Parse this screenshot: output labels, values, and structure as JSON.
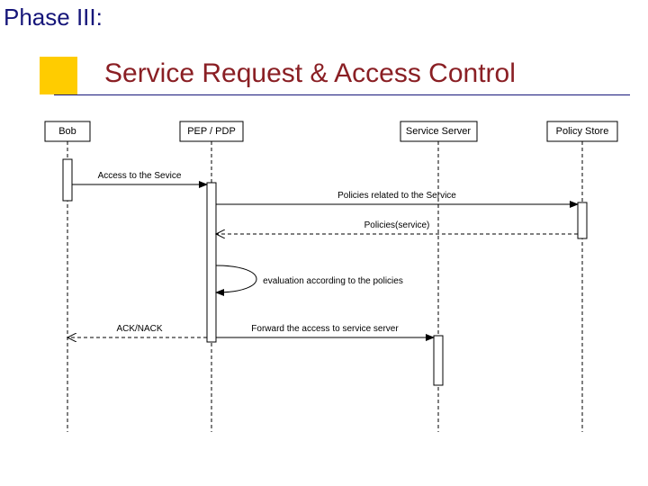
{
  "header": {
    "phase": "Phase III:",
    "title": "Service Request & Access Control"
  },
  "lifelines": {
    "bob": "Bob",
    "pep": "PEP / PDP",
    "svc": "Service Server",
    "pol": "Policy Store"
  },
  "messages": {
    "m1": "Access to the Sevice",
    "m2": "Policies related to the Service",
    "m3": "Policies(service)",
    "m4": "evaluation according to the policies",
    "m5a": "ACK/NACK",
    "m5b": "Forward the access to service server"
  },
  "chart_data": {
    "type": "sequence-diagram",
    "participants": [
      "Bob",
      "PEP / PDP",
      "Service Server",
      "Policy Store"
    ],
    "interactions": [
      {
        "from": "Bob",
        "to": "PEP / PDP",
        "text": "Access to the Sevice",
        "kind": "sync"
      },
      {
        "from": "PEP / PDP",
        "to": "Policy Store",
        "text": "Policies related to the Service",
        "kind": "sync"
      },
      {
        "from": "Policy Store",
        "to": "PEP / PDP",
        "text": "Policies(service)",
        "kind": "return"
      },
      {
        "from": "PEP / PDP",
        "to": "PEP / PDP",
        "text": "evaluation according to the policies",
        "kind": "self"
      },
      {
        "from": "PEP / PDP",
        "to": "Bob",
        "text": "ACK/NACK",
        "kind": "return"
      },
      {
        "from": "PEP / PDP",
        "to": "Service Server",
        "text": "Forward the access to service server",
        "kind": "sync"
      }
    ]
  }
}
